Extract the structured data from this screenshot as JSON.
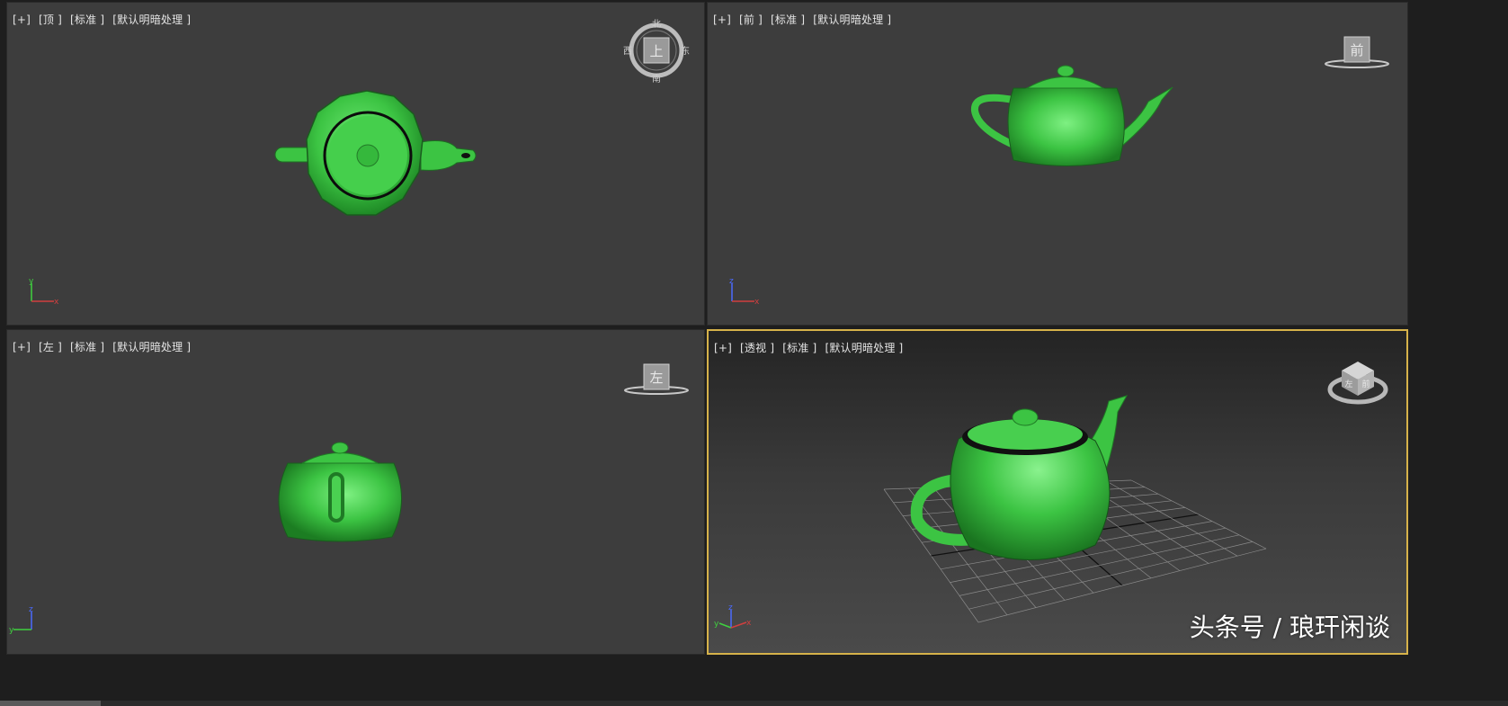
{
  "viewports": {
    "top": {
      "menu": [
        "[+]",
        "[顶 ]",
        "[标准 ]",
        "[默认明暗处理 ]"
      ],
      "cube_face": "上",
      "compass": {
        "north": "北",
        "south": "南",
        "east": "东",
        "west": "西"
      },
      "axes": {
        "vertical": "y",
        "horizontal": "x"
      }
    },
    "front": {
      "menu": [
        "[+]",
        "[前 ]",
        "[标准 ]",
        "[默认明暗处理 ]"
      ],
      "cube_face": "前",
      "axes": {
        "vertical": "z",
        "horizontal": "x"
      }
    },
    "left": {
      "menu": [
        "[+]",
        "[左 ]",
        "[标准 ]",
        "[默认明暗处理 ]"
      ],
      "cube_face": "左",
      "axes": {
        "vertical": "z",
        "horizontal": "y"
      }
    },
    "perspective": {
      "menu": [
        "[+]",
        "[透视 ]",
        "[标准 ]",
        "[默认明暗处理 ]"
      ],
      "cube_face_front": "前",
      "cube_face_left": "左",
      "axes": {
        "vertical": "z",
        "left": "y",
        "right": "x"
      }
    }
  },
  "watermark": "头条号 / 琅玕闲谈",
  "colors": {
    "teapot": "#3fc646",
    "viewport_bg": "#3d3d3d",
    "active_border": "#d6b24a",
    "grid": "#8a8a8a"
  }
}
